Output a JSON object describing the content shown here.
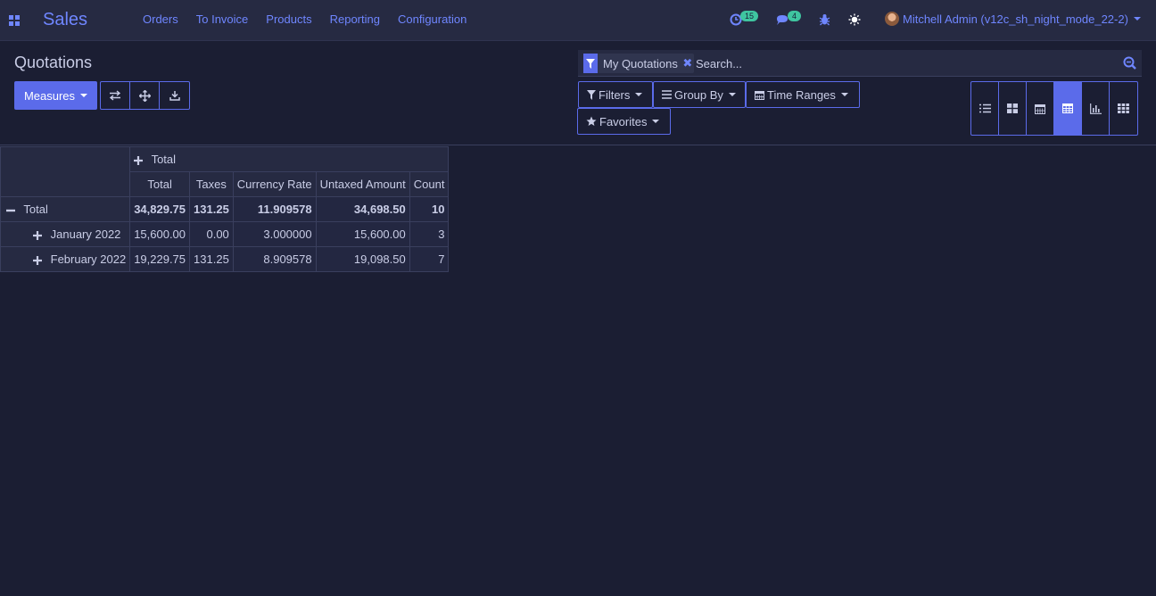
{
  "navbar": {
    "brand": "Sales",
    "menu": [
      "Orders",
      "To Invoice",
      "Products",
      "Reporting",
      "Configuration"
    ],
    "activity_count": "15",
    "messages_count": "4",
    "user": "Mitchell Admin (v12c_sh_night_mode_22-2)"
  },
  "control": {
    "breadcrumb": "Quotations",
    "measures_label": "Measures",
    "facet_label": "My Quotations",
    "search_placeholder": "Search...",
    "filters_label": "Filters",
    "groupby_label": "Group By",
    "timeranges_label": "Time Ranges",
    "favorites_label": "Favorites"
  },
  "pivot": {
    "col_group": "Total",
    "measures": [
      "Total",
      "Taxes",
      "Currency Rate",
      "Untaxed Amount",
      "Count"
    ],
    "rows": [
      {
        "label": "Total",
        "values": [
          "34,829.75",
          "131.25",
          "11.909578",
          "34,698.50",
          "10"
        ]
      },
      {
        "label": "January 2022",
        "values": [
          "15,600.00",
          "0.00",
          "3.000000",
          "15,600.00",
          "3"
        ]
      },
      {
        "label": "February 2022",
        "values": [
          "19,229.75",
          "131.25",
          "8.909578",
          "19,098.50",
          "7"
        ]
      }
    ]
  },
  "colors": {
    "accent": "#5b6bea",
    "link": "#6f86ff",
    "background": "#1b1e33",
    "badge": "#3fc5a0"
  }
}
